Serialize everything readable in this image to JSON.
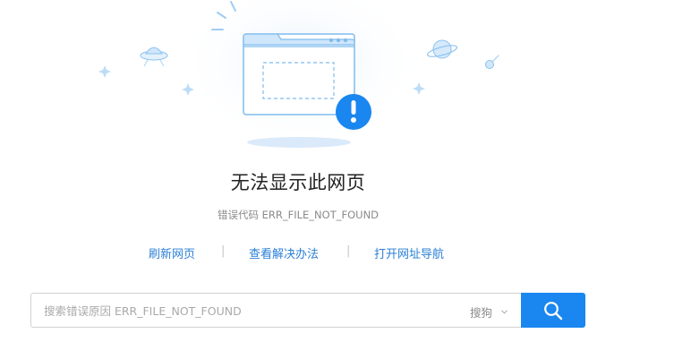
{
  "error": {
    "title": "无法显示此网页",
    "code_text": "错误代码 ERR_FILE_NOT_FOUND"
  },
  "actions": {
    "refresh_label": "刷新网页",
    "solution_label": "查看解决办法",
    "nav_label": "打开网址导航",
    "separator": "|"
  },
  "search": {
    "placeholder": "搜索错误原因 ERR_FILE_NOT_FOUND",
    "engine_label": "搜狗"
  },
  "icons": {
    "search_button": "search-icon",
    "engine_dropdown": "chevron-down-icon",
    "alert_badge": "exclamation-icon"
  },
  "colors": {
    "accent": "#1a86f0",
    "link": "#2a7fd6",
    "illustration_blue": "#7fbcee"
  }
}
